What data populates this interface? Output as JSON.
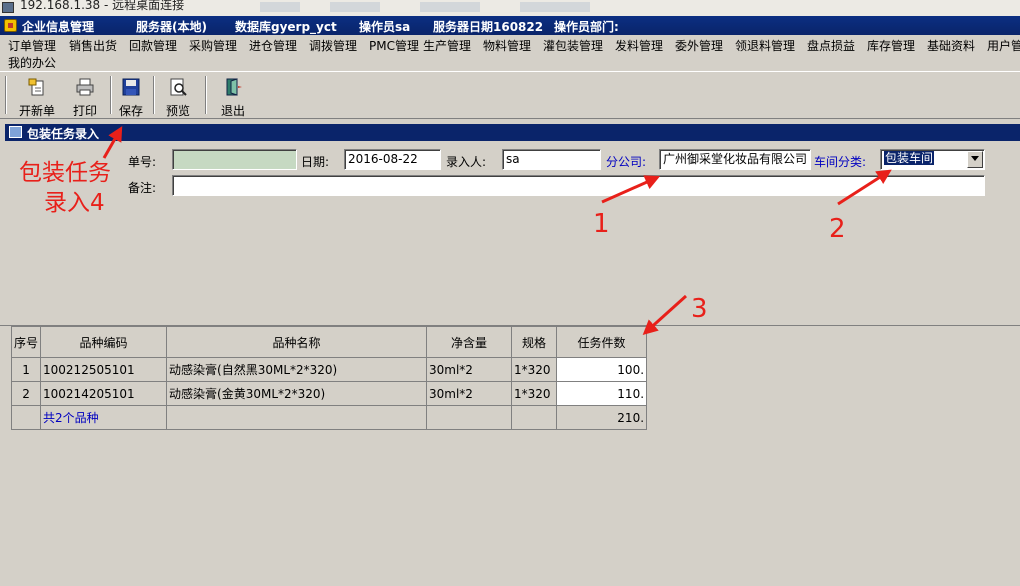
{
  "remote_bar": {
    "title": "192.168.1.38 - 远程桌面连接"
  },
  "app_title": {
    "system": "企业信息管理",
    "server": "服务器(本地)",
    "database": "数据库gyerp_yct",
    "operator": "操作员sa",
    "server_date": "服务器日期160822",
    "department": "操作员部门:"
  },
  "menu": {
    "items": [
      "订单管理",
      "销售出货",
      "回款管理",
      "采购管理",
      "进仓管理",
      "调拨管理",
      "PMC管理",
      "生产管理",
      "物料管理",
      "灌包装管理",
      "发料管理",
      "委外管理",
      "领退料管理",
      "盘点损益",
      "库存管理",
      "基础资料",
      "用户管"
    ],
    "second_row": "我的办公"
  },
  "toolbar": {
    "new_label": "开新单",
    "print_label": "打印",
    "save_label": "保存",
    "preview_label": "预览",
    "exit_label": "退出"
  },
  "form": {
    "caption": "包装任务录入",
    "order_no_label": "单号:",
    "order_no_value": "",
    "date_label": "日期:",
    "date_value": "2016-08-22",
    "entry_user_label": "录入人:",
    "entry_user_value": "sa",
    "branch_label": "分公司:",
    "branch_value": "广州御采堂化妆品有限公司",
    "workshop_label": "车间分类:",
    "workshop_value": "包装车间",
    "remark_label": "备注:",
    "remark_value": ""
  },
  "grid": {
    "headers": [
      "序号",
      "品种编码",
      "品种名称",
      "净含量",
      "规格",
      "任务件数"
    ],
    "rows": [
      {
        "seq": "1",
        "code": "100212505101",
        "name": "动感染膏(自然黑30ML*2*320)",
        "net": "30ml*2",
        "spec": "1*320",
        "qty": "100."
      },
      {
        "seq": "2",
        "code": "100214205101",
        "name": "动感染膏(金黄30ML*2*320)",
        "net": "30ml*2",
        "spec": "1*320",
        "qty": "110."
      }
    ],
    "summary": {
      "label": "共2个品种",
      "total": "210."
    }
  },
  "annotations": {
    "note_line1": "包装任务",
    "note_line2": "录入4",
    "n1": "1",
    "n2": "2",
    "n3": "3"
  },
  "colors": {
    "window_bg": "#d4d0c8",
    "title_bar": "#0a246a",
    "annotation_red": "#e8201a",
    "label_blue": "#0000c0",
    "order_field_green": "#c6d9c2"
  }
}
